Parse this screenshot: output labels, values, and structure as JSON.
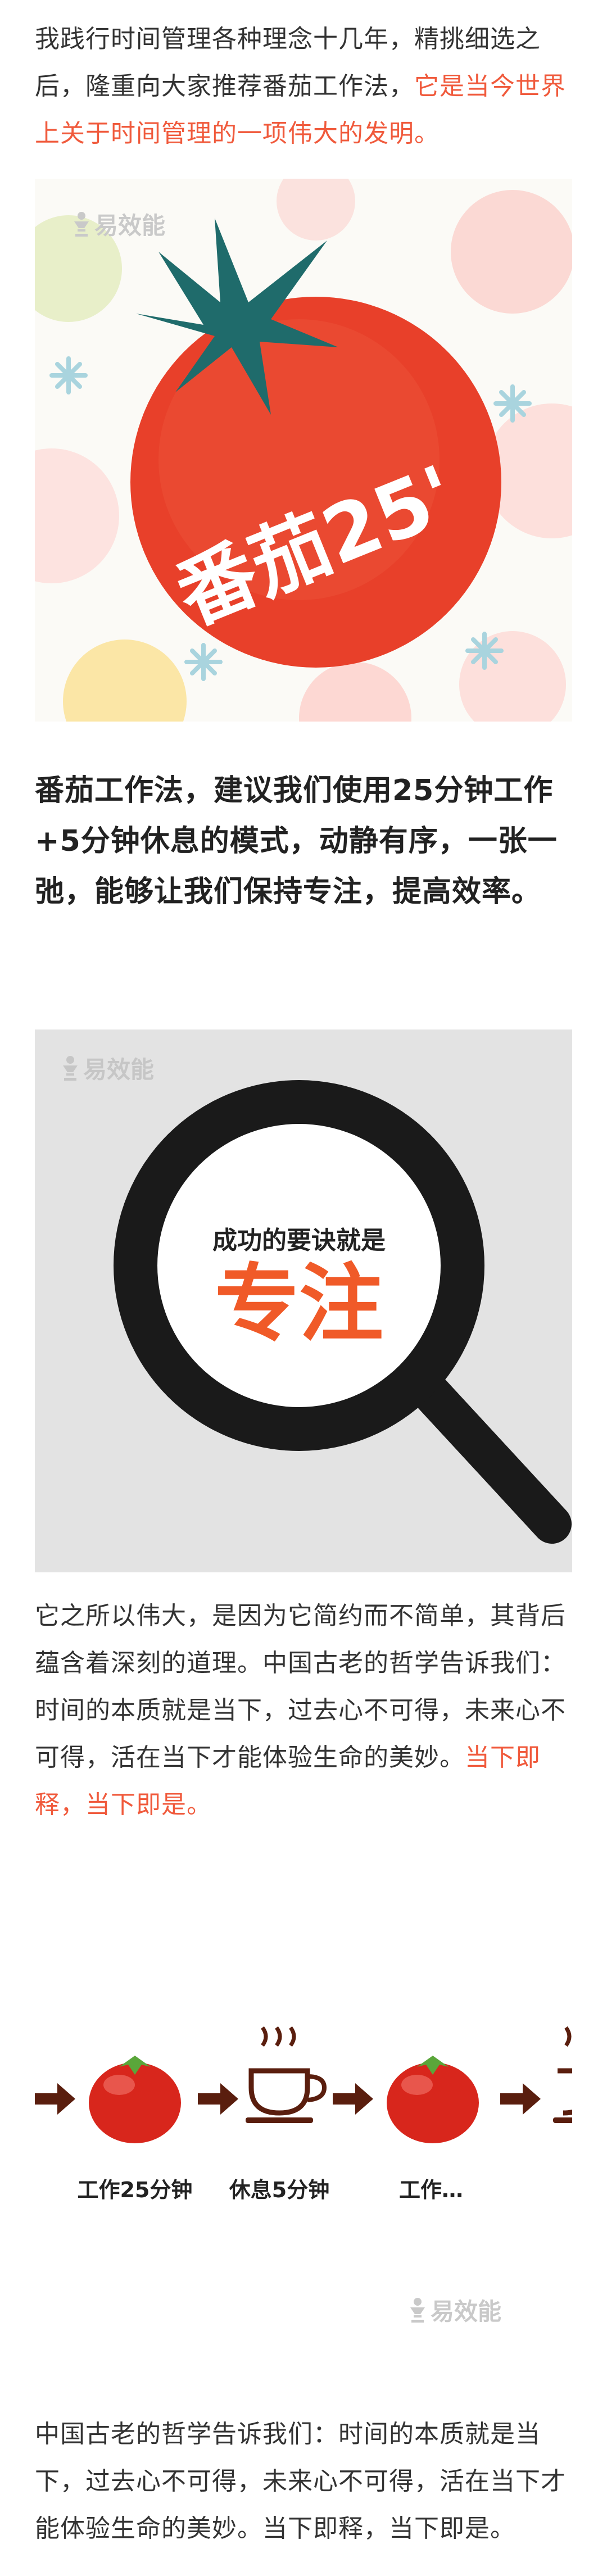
{
  "intro": {
    "text_plain": "我践行时间管理各种理念十几年，精挑细选之后，隆重向大家推荐番茄工作法，",
    "text_accent": "它是当今世界上关于时间管理的一项伟大的发明。"
  },
  "figure1": {
    "logo": "易效能",
    "stamp": "番茄25'"
  },
  "summary": {
    "text": "番茄工作法，建议我们使用25分钟工作+5分钟休息的模式，动静有序，一张一弛，能够让我们保持专注，提高效率。"
  },
  "figure2": {
    "logo": "易效能",
    "lens_caption": "成功的要诀就是",
    "lens_word": "专注"
  },
  "body": {
    "text_plain": "它之所以伟大，是因为它简约而不简单，其背后蕴含着深刻的道理。中国古老的哲学告诉我们：时间的本质就是当下，过去心不可得，未来心不可得，活在当下才能体验生命的美妙。",
    "text_accent": "当下即释，当下即是。"
  },
  "figure3": {
    "labels": [
      "工作25分钟",
      "休息5分钟",
      "工作…"
    ],
    "logo": "易效能"
  },
  "closing": {
    "text": "中国古老的哲学告诉我们：时间的本质就是当下，过去心不可得，未来心不可得，活在当下才能体验生命的美妙。当下即释，当下即是。"
  },
  "colors": {
    "accent": "#f05a3c",
    "tomato": "#e8402a",
    "leaf": "#1f6b6b",
    "lens_word": "#f05a28"
  }
}
